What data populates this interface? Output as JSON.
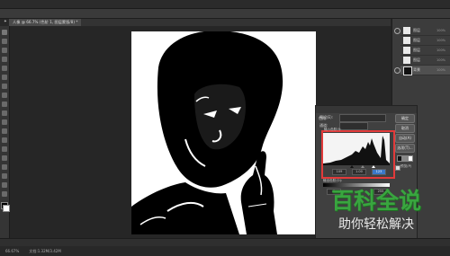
{
  "menubar": {
    "items": [
      "PS",
      "文件",
      "编辑",
      "图像",
      "图层",
      "文字",
      "选择",
      "滤镜",
      "3D",
      "视图",
      "窗口",
      "帮助"
    ]
  },
  "optionsbar": {
    "items": [
      "✦",
      "预设",
      "默认"
    ]
  },
  "document_tab": {
    "label": "人像 @ 66.7% (色阶 1, 图层蒙版/8) *"
  },
  "layers_panel": {
    "rows": [
      {
        "name": "图层",
        "opacity": "100%"
      },
      {
        "name": "图层",
        "opacity": "100%"
      },
      {
        "name": "图层",
        "opacity": "100%"
      },
      {
        "name": "图层",
        "opacity": "100%"
      },
      {
        "name": "背景",
        "opacity": "100%"
      }
    ]
  },
  "levels_dialog": {
    "title": "色阶",
    "preset_label": "预设(E):",
    "preset_value": "默认",
    "channel_label": "通道:",
    "channel_value": "RGB",
    "input_label": "输入色阶(I):",
    "input_values": [
      "109",
      "1.00",
      "123"
    ],
    "output_label": "输出色阶(O):",
    "output_values": [
      "0",
      "255"
    ],
    "buttons": {
      "ok": "确定",
      "cancel": "取消",
      "auto": "自动(A)",
      "options": "选项(T)..."
    },
    "preview_label": "预览(P)"
  },
  "statusbar": {
    "zoom": "66.67%",
    "doc": "文档:1.32M/3.42M"
  },
  "watermark": {
    "title": "百科全说",
    "subtitle": "助你轻松解决"
  },
  "colors": {
    "accent_red": "#e23a3a",
    "watermark_green": "#39a53f"
  }
}
